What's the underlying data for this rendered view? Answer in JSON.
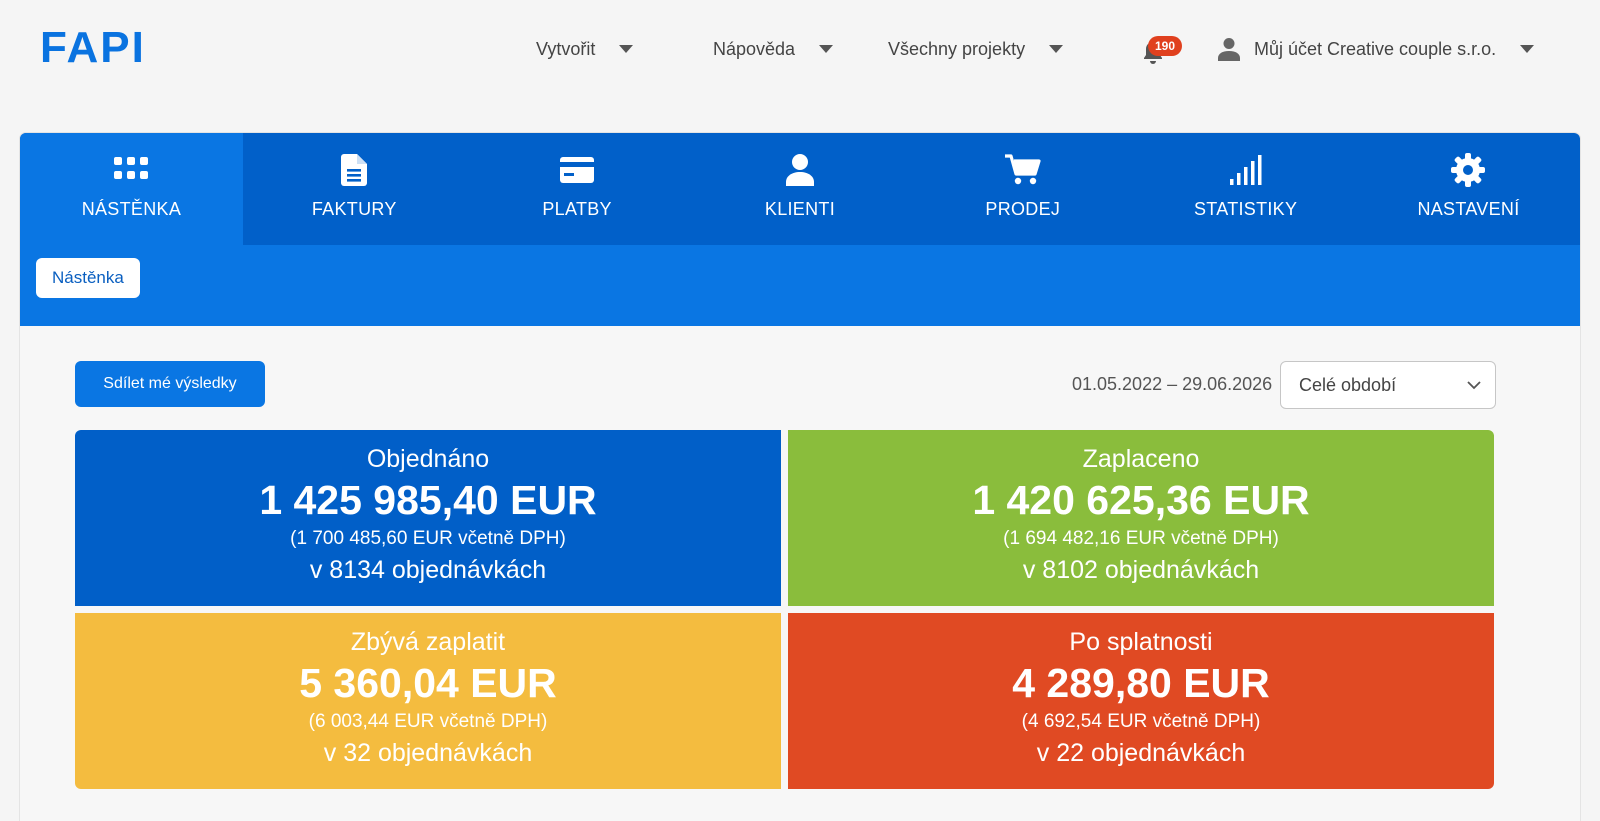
{
  "logo": "FAPI",
  "topnav": {
    "create": "Vytvořit",
    "help": "Nápověda",
    "projects": "Všechny projekty",
    "notifications_count": "190",
    "account": "Můj účet Creative couple s.r.o."
  },
  "tabs": [
    {
      "label": "NÁSTĚNKA",
      "icon": "grid-icon",
      "active": true
    },
    {
      "label": "FAKTURY",
      "icon": "document-icon",
      "active": false
    },
    {
      "label": "PLATBY",
      "icon": "credit-card-icon",
      "active": false
    },
    {
      "label": "KLIENTI",
      "icon": "user-icon",
      "active": false
    },
    {
      "label": "PRODEJ",
      "icon": "cart-icon",
      "active": false
    },
    {
      "label": "STATISTIKY",
      "icon": "signal-bars-icon",
      "active": false
    },
    {
      "label": "NASTAVENÍ",
      "icon": "gear-icon",
      "active": false
    }
  ],
  "subtab": "Nástěnka",
  "share_button": "Sdílet mé výsledky",
  "date_range": "01.05.2022 – 29.06.2026",
  "period_select": "Celé období",
  "stats": {
    "ordered": {
      "title": "Objednáno",
      "value": "1 425 985,40 EUR",
      "vat": "(1 700 485,60 EUR včetně DPH)",
      "orders": "v 8134 objednávkách",
      "color": "#015fc8"
    },
    "paid": {
      "title": "Zaplaceno",
      "value": "1 420 625,36 EUR",
      "vat": "(1 694 482,16 EUR včetně DPH)",
      "orders": "v 8102 objednávkách",
      "color": "#8abd3c"
    },
    "remaining": {
      "title": "Zbývá zaplatit",
      "value": "5 360,04 EUR",
      "vat": "(6 003,44 EUR včetně DPH)",
      "orders": "v 32 objednávkách",
      "color": "#f4bc3f"
    },
    "overdue": {
      "title": "Po splatnosti",
      "value": "4 289,80 EUR",
      "vat": "(4 692,54 EUR včetně DPH)",
      "orders": "v 22 objednávkách",
      "color": "#e04a23"
    }
  }
}
